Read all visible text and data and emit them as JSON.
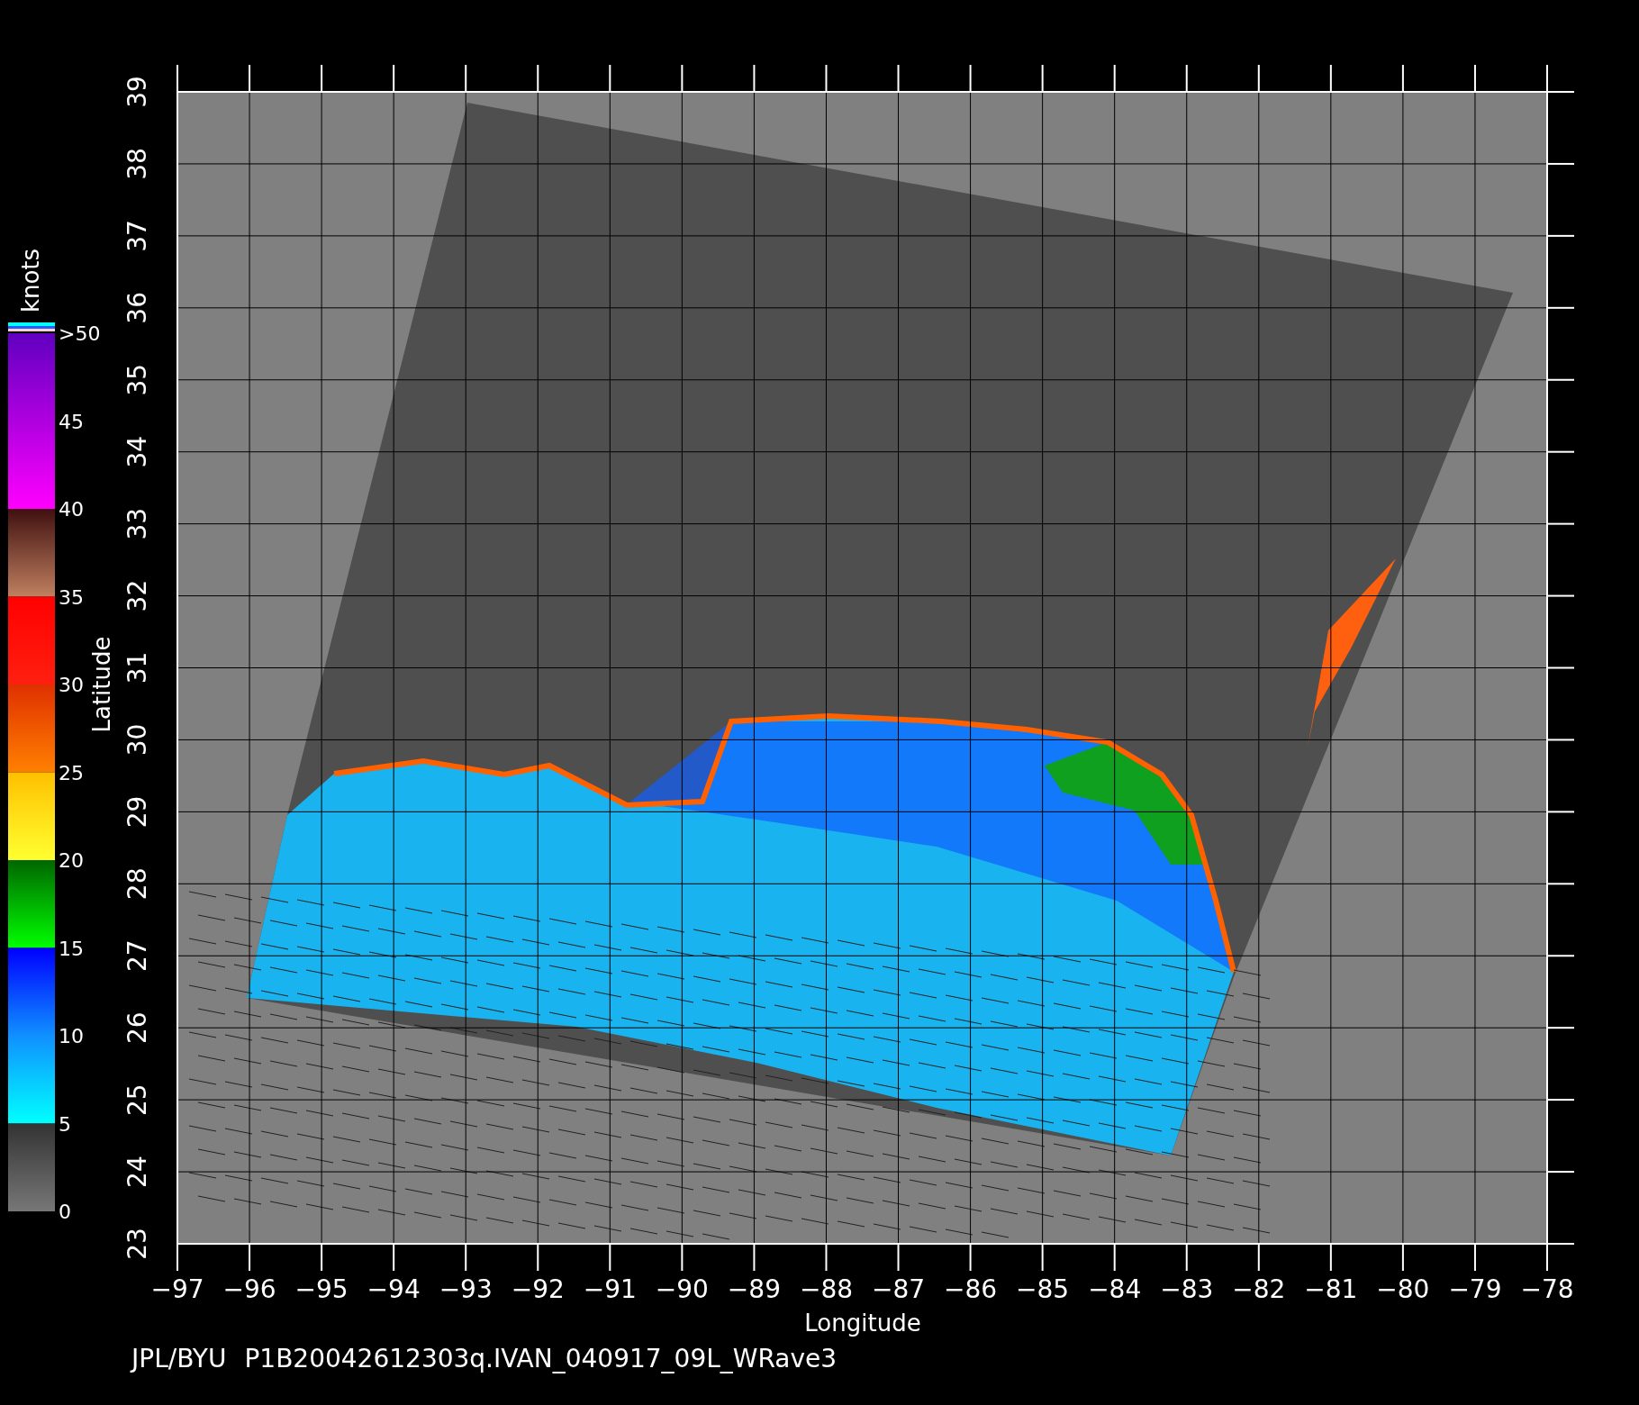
{
  "colorbar": {
    "unit": "knots",
    "labels": [
      ">50",
      "45",
      "40",
      "35",
      "30",
      "25",
      "20",
      "15",
      "10",
      "5",
      "0"
    ]
  },
  "map": {
    "ylabel": "Latitude",
    "xlabel": "Longitude",
    "yticks": [
      "39",
      "38",
      "37",
      "36",
      "35",
      "34",
      "33",
      "32",
      "31",
      "30",
      "29",
      "28",
      "27",
      "26",
      "25",
      "24",
      "23"
    ],
    "xticks": [
      "−97",
      "−96",
      "−95",
      "−94",
      "−93",
      "−92",
      "−91",
      "−90",
      "−89",
      "−88",
      "−87",
      "−86",
      "−85",
      "−84",
      "−83",
      "−82",
      "−81",
      "−80",
      "−79",
      "−78"
    ]
  },
  "caption": [
    "JPL/BYU",
    "P1B20042612303q.IVAN_040917_09L_WRave3"
  ]
}
